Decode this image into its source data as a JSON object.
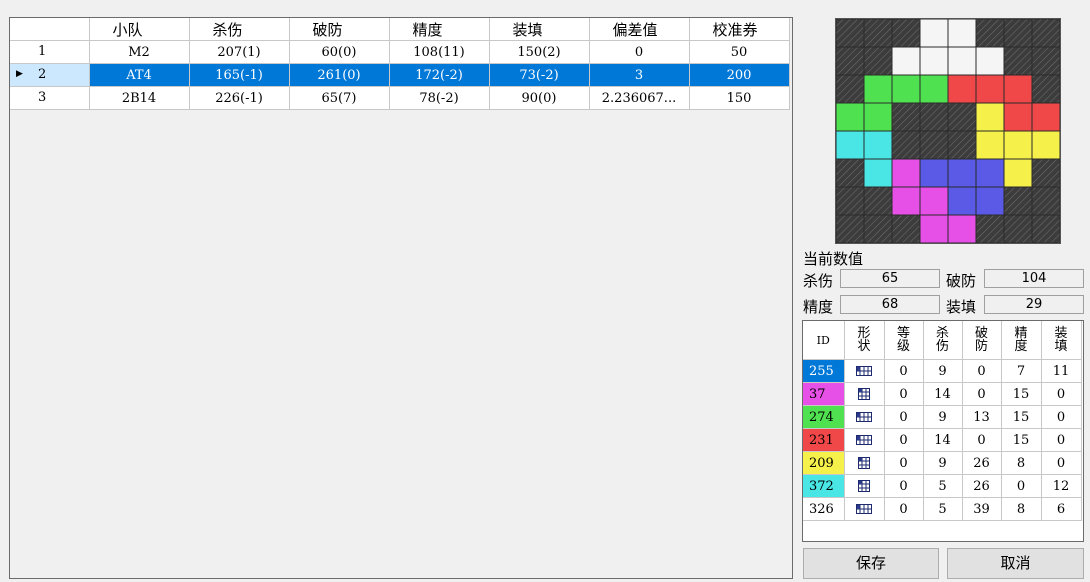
{
  "grid": {
    "columns": [
      "小队",
      "杀伤",
      "破防",
      "精度",
      "装填",
      "偏差值",
      "校准券"
    ],
    "rows": [
      {
        "num": "1",
        "squad": "M2",
        "kill": "207(1)",
        "break": "60(0)",
        "precision": "108(11)",
        "reload": "150(2)",
        "deviation": "0",
        "voucher": "50",
        "selected": false
      },
      {
        "num": "2",
        "squad": "AT4",
        "kill": "165(-1)",
        "break": "261(0)",
        "precision": "172(-2)",
        "reload": "73(-2)",
        "deviation": "3",
        "voucher": "200",
        "selected": true
      },
      {
        "num": "3",
        "squad": "2B14",
        "kill": "226(-1)",
        "break": "65(7)",
        "precision": "78(-2)",
        "reload": "90(0)",
        "deviation": "2.236067...",
        "voucher": "150",
        "selected": false
      }
    ]
  },
  "board": {
    "cells": [
      [
        "x",
        "x",
        "x",
        "w",
        "w",
        "x",
        "x",
        "x"
      ],
      [
        "x",
        "x",
        "w",
        "w",
        "w",
        "w",
        "x",
        "x"
      ],
      [
        "x",
        "g",
        "g",
        "g",
        "r",
        "r",
        "r",
        "x"
      ],
      [
        "g",
        "g",
        "x",
        "x",
        "x",
        "y",
        "r",
        "r"
      ],
      [
        "c",
        "c",
        "x",
        "x",
        "x",
        "y",
        "y",
        "y"
      ],
      [
        "x",
        "c",
        "m",
        "b",
        "b",
        "b",
        "y",
        "x"
      ],
      [
        "x",
        "x",
        "m",
        "m",
        "b",
        "b",
        "x",
        "x"
      ],
      [
        "x",
        "x",
        "x",
        "m",
        "m",
        "x",
        "x",
        "x"
      ]
    ],
    "palette": {
      "x": "#3c3c3c",
      "w": "#f5f5f5",
      "g": "#50e150",
      "r": "#f04848",
      "y": "#f5f04a",
      "c": "#4ae6e6",
      "m": "#e650e6",
      "b": "#5a5ae6"
    }
  },
  "current": {
    "title": "当前数值",
    "kill_label": "杀伤",
    "kill_value": "65",
    "break_label": "破防",
    "break_value": "104",
    "precision_label": "精度",
    "precision_value": "68",
    "reload_label": "装填",
    "reload_value": "29"
  },
  "modules": {
    "columns": [
      "ID",
      "形状",
      "等级",
      "杀伤",
      "破防",
      "精度",
      "装填"
    ],
    "rows": [
      {
        "id": "255",
        "color": "#0078d7",
        "text_color": "#ffffff",
        "shape": "bar",
        "level": "0",
        "kill": "9",
        "break": "0",
        "precision": "7",
        "reload": "11"
      },
      {
        "id": "37",
        "color": "#e650e6",
        "text_color": "#000000",
        "shape": "sq",
        "level": "0",
        "kill": "14",
        "break": "0",
        "precision": "15",
        "reload": "0"
      },
      {
        "id": "274",
        "color": "#50e150",
        "text_color": "#000000",
        "shape": "bar",
        "level": "0",
        "kill": "9",
        "break": "13",
        "precision": "15",
        "reload": "0"
      },
      {
        "id": "231",
        "color": "#f04848",
        "text_color": "#000000",
        "shape": "bar",
        "level": "0",
        "kill": "14",
        "break": "0",
        "precision": "15",
        "reload": "0"
      },
      {
        "id": "209",
        "color": "#f5f04a",
        "text_color": "#000000",
        "shape": "sq",
        "level": "0",
        "kill": "9",
        "break": "26",
        "precision": "8",
        "reload": "0"
      },
      {
        "id": "372",
        "color": "#4ae6e6",
        "text_color": "#000000",
        "shape": "sq",
        "level": "0",
        "kill": "5",
        "break": "26",
        "precision": "0",
        "reload": "12"
      },
      {
        "id": "326",
        "color": "#ffffff",
        "text_color": "#000000",
        "shape": "bar",
        "level": "0",
        "kill": "5",
        "break": "39",
        "precision": "8",
        "reload": "6"
      }
    ]
  },
  "buttons": {
    "save": "保存",
    "cancel": "取消"
  },
  "icons": {
    "selected_row": "triangle-right-icon",
    "shape_bar": "grid-bar-icon",
    "shape_square": "grid-square-icon"
  }
}
